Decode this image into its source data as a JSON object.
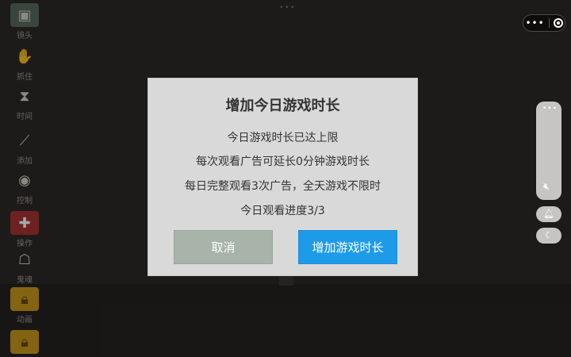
{
  "toolbar": {
    "items": [
      {
        "label": "镜头",
        "icon": "camera-icon"
      },
      {
        "label": "抓住",
        "icon": "hand-icon"
      },
      {
        "label": "时间",
        "icon": "hourglass-icon"
      },
      {
        "label": "添加",
        "icon": "wand-icon"
      },
      {
        "label": "控制",
        "icon": "controller-icon"
      },
      {
        "label": "操作",
        "icon": "plus-icon"
      },
      {
        "label": "鬼魂",
        "icon": "ghost-icon"
      },
      {
        "label": "动画",
        "icon": "lock-icon"
      },
      {
        "label": "",
        "icon": "lock-icon"
      }
    ]
  },
  "capsule": {
    "more_icon": "more-icon",
    "close_icon": "close-target-icon"
  },
  "side_panel": {
    "dots": "•••",
    "mute_icon": "mute-icon"
  },
  "side_buttons": [
    {
      "icon": "bell-icon"
    },
    {
      "icon": "moon-icon"
    }
  ],
  "dialog": {
    "title": "增加今日游戏时长",
    "lines": [
      "今日游戏时长已达上限",
      "每次观看广告可延长0分钟游戏时长",
      "每日完整观看3次广告，全天游戏不限时",
      "今日观看进度3/3"
    ],
    "cancel_label": "取消",
    "confirm_label": "增加游戏时长"
  },
  "colors": {
    "confirm": "#1e9be8",
    "cancel": "#a8b3a9",
    "dialog_bg": "#d9d9d9"
  }
}
